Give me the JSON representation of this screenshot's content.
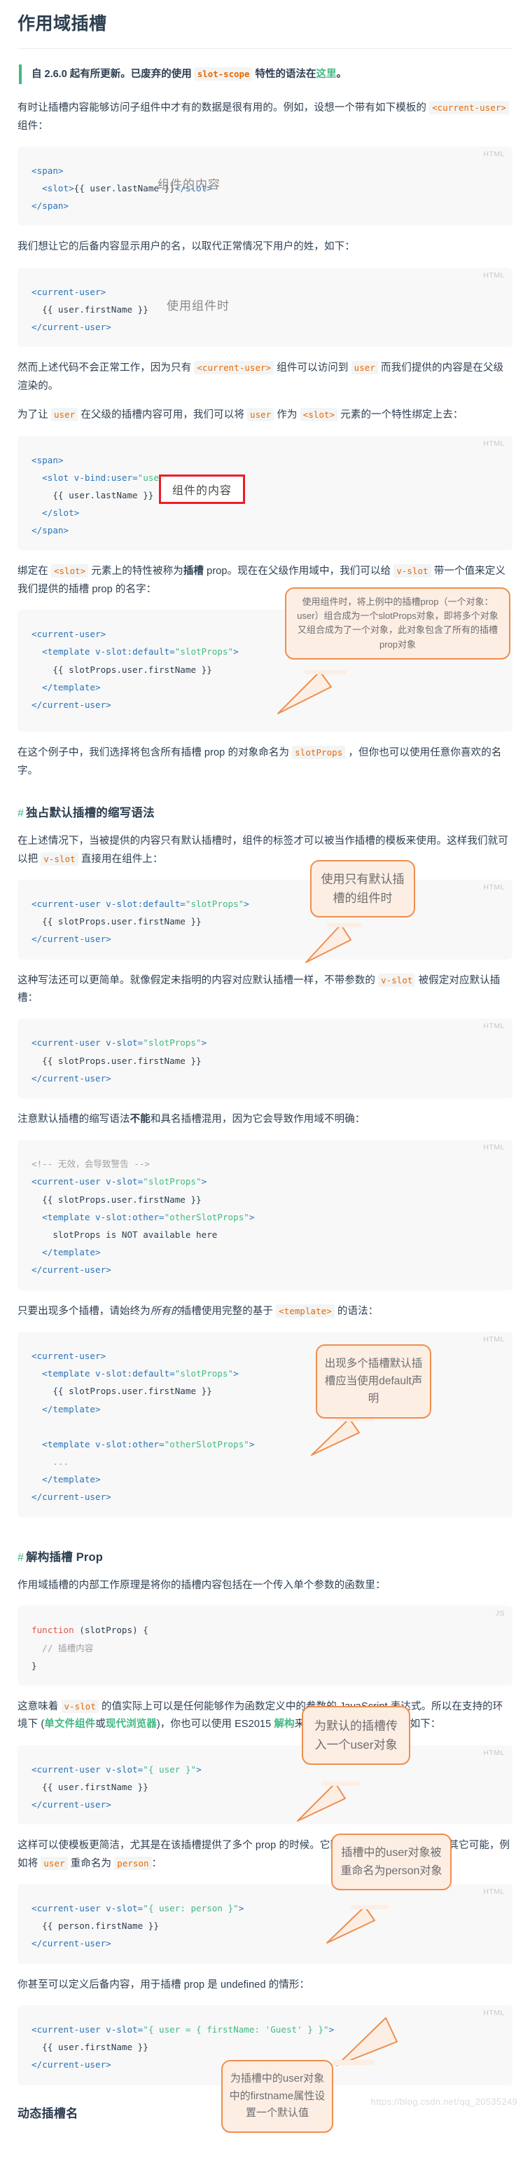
{
  "page": {
    "title": "作用域插槽",
    "watermark": "https://blog.csdn.net/qq_20535249"
  },
  "tip": {
    "prefix": "自 2.6.0 起有所更新。已废弃的使用 ",
    "code": "slot-scope",
    "middle": " 特性的语法在",
    "link": "这里",
    "suffix": "。"
  },
  "paragraphs": {
    "p1_a": "有时让插槽内容能够访问子组件中才有的数据是很有用的。例如，设想一个带有如下模板的 ",
    "p1_code": "<current-user>",
    "p1_b": " 组件：",
    "p2": "我们想让它的后备内容显示用户的名，以取代正常情况下用户的姓，如下：",
    "p3_a": "然而上述代码不会正常工作，因为只有 ",
    "p3_code1": "<current-user>",
    "p3_b": " 组件可以访问到 ",
    "p3_code2": "user",
    "p3_c": " 而我们提供的内容是在父级渲染的。",
    "p4_a": "为了让 ",
    "p4_code1": "user",
    "p4_b": " 在父级的插槽内容可用，我们可以将 ",
    "p4_code2": "user",
    "p4_c": " 作为 ",
    "p4_code3": "<slot>",
    "p4_d": " 元素的一个特性绑定上去：",
    "p5_a": "绑定在 ",
    "p5_code1": "<slot>",
    "p5_b": " 元素上的特性被称为",
    "p5_strong": "插槽",
    "p5_c": " prop。现在在父级作用域中，我们可以给 ",
    "p5_code2": "v-slot",
    "p5_d": " 带一个值来定义我们提供的插槽 prop 的名字：",
    "p6_a": "在这个例子中，我们选择将包含所有插槽 prop 的对象命名为 ",
    "p6_code": "slotProps",
    "p6_b": " ，但你也可以使用任意你喜欢的名字。",
    "p7_a": "在上述情况下，当被提供的内容只有默认插槽时，组件的标签才可以被当作插槽的模板来使用。这样我们就可以把 ",
    "p7_code": "v-slot",
    "p7_b": " 直接用在组件上：",
    "p8_a": "这种写法还可以更简单。就像假定未指明的内容对应默认插槽一样，不带参数的 ",
    "p8_code": "v-slot",
    "p8_b": " 被假定对应默认插槽：",
    "p9_a": "注意默认插槽的缩写语法",
    "p9_strong": "不能",
    "p9_b": "和具名插槽混用，因为它会导致作用域不明确：",
    "p10_a": "只要出现多个插槽，请始终为",
    "p10_em": "所有的",
    "p10_b": "插槽使用完整的基于 ",
    "p10_code": "<template>",
    "p10_c": " 的语法：",
    "p11": "作用域插槽的内部工作原理是将你的插槽内容包括在一个传入单个参数的函数里：",
    "p12_a": "这意味着 ",
    "p12_code": "v-slot",
    "p12_b": " 的值实际上可以是任何能够作为函数定义中的参数的 JavaScript 表达式。所以在支持的环境下 (",
    "p12_link1": "单文件组件",
    "p12_c": "或",
    "p12_link2": "现代浏览器",
    "p12_d": ")，你也可以使用 ",
    "p12_es": "ES2015",
    "p12_e": " ",
    "p12_link3": "解构",
    "p12_f": "来传入具体的插槽 prop，如下：",
    "p13_a": "这样可以使模板更简洁，尤其是在该插槽提供了多个 prop 的时候。它同样开启了 prop 重命名等其它可能，例如将 ",
    "p13_code1": "user",
    "p13_b": " 重命名为 ",
    "p13_code2": "person",
    "p13_c": "：",
    "p14": "你甚至可以定义后备内容，用于插槽 prop 是 undefined 的情形："
  },
  "sections": {
    "s1_anchor": "#",
    "s1_title": "独占默认插槽的缩写语法",
    "s2_anchor": "#",
    "s2_title": "解构插槽 Prop",
    "s3_title": "动态插槽名"
  },
  "code_blocks": [
    {
      "id": "cb1",
      "lang": "HTML",
      "lines": [
        [
          {
            "t": "tag",
            "v": "<span>"
          }
        ],
        [
          {
            "t": "txt",
            "v": "  "
          },
          {
            "t": "tag",
            "v": "<slot>"
          },
          {
            "t": "txt",
            "v": "{{ user.lastName }}"
          },
          {
            "t": "tag",
            "v": "</slot>"
          }
        ],
        [
          {
            "t": "tag",
            "v": "</span>"
          }
        ]
      ]
    },
    {
      "id": "cb2",
      "lang": "HTML",
      "lines": [
        [
          {
            "t": "tag",
            "v": "<current-user>"
          }
        ],
        [
          {
            "t": "txt",
            "v": "  {{ user.firstName }}"
          }
        ],
        [
          {
            "t": "tag",
            "v": "</current-user>"
          }
        ]
      ]
    },
    {
      "id": "cb3",
      "lang": "HTML",
      "lines": [
        [
          {
            "t": "tag",
            "v": "<span>"
          }
        ],
        [
          {
            "t": "txt",
            "v": "  "
          },
          {
            "t": "tag",
            "v": "<slot v-bind:user="
          },
          {
            "t": "str",
            "v": "\"user\""
          },
          {
            "t": "tag",
            "v": ">"
          }
        ],
        [
          {
            "t": "txt",
            "v": "    {{ user.lastName }}"
          }
        ],
        [
          {
            "t": "txt",
            "v": "  "
          },
          {
            "t": "tag",
            "v": "</slot>"
          }
        ],
        [
          {
            "t": "tag",
            "v": "</span>"
          }
        ]
      ]
    },
    {
      "id": "cb4",
      "lang": "HTML",
      "lines": [
        [
          {
            "t": "tag",
            "v": "<current-user>"
          }
        ],
        [
          {
            "t": "txt",
            "v": "  "
          },
          {
            "t": "tag",
            "v": "<template v-slot:default="
          },
          {
            "t": "str",
            "v": "\"slotProps\""
          },
          {
            "t": "tag",
            "v": ">"
          }
        ],
        [
          {
            "t": "txt",
            "v": "    {{ slotProps.user.firstName }}"
          }
        ],
        [
          {
            "t": "txt",
            "v": "  "
          },
          {
            "t": "tag",
            "v": "</template>"
          }
        ],
        [
          {
            "t": "tag",
            "v": "</current-user>"
          }
        ]
      ]
    },
    {
      "id": "cb5",
      "lang": "HTML",
      "lines": [
        [
          {
            "t": "tag",
            "v": "<current-user v-slot:default="
          },
          {
            "t": "str",
            "v": "\"slotProps\""
          },
          {
            "t": "tag",
            "v": ">"
          }
        ],
        [
          {
            "t": "txt",
            "v": "  {{ slotProps.user.firstName }}"
          }
        ],
        [
          {
            "t": "tag",
            "v": "</current-user>"
          }
        ]
      ]
    },
    {
      "id": "cb6",
      "lang": "HTML",
      "lines": [
        [
          {
            "t": "tag",
            "v": "<current-user v-slot="
          },
          {
            "t": "str",
            "v": "\"slotProps\""
          },
          {
            "t": "tag",
            "v": ">"
          }
        ],
        [
          {
            "t": "txt",
            "v": "  {{ slotProps.user.firstName }}"
          }
        ],
        [
          {
            "t": "tag",
            "v": "</current-user>"
          }
        ]
      ]
    },
    {
      "id": "cb7",
      "lang": "HTML",
      "lines": [
        [
          {
            "t": "cmt",
            "v": "<!-- 无效，会导致警告 -->"
          }
        ],
        [
          {
            "t": "tag",
            "v": "<current-user v-slot="
          },
          {
            "t": "str",
            "v": "\"slotProps\""
          },
          {
            "t": "tag",
            "v": ">"
          }
        ],
        [
          {
            "t": "txt",
            "v": "  {{ slotProps.user.firstName }}"
          }
        ],
        [
          {
            "t": "txt",
            "v": "  "
          },
          {
            "t": "tag",
            "v": "<template v-slot:other="
          },
          {
            "t": "str",
            "v": "\"otherSlotProps\""
          },
          {
            "t": "tag",
            "v": ">"
          }
        ],
        [
          {
            "t": "txt",
            "v": "    slotProps is NOT available here"
          }
        ],
        [
          {
            "t": "txt",
            "v": "  "
          },
          {
            "t": "tag",
            "v": "</template>"
          }
        ],
        [
          {
            "t": "tag",
            "v": "</current-user>"
          }
        ]
      ]
    },
    {
      "id": "cb8",
      "lang": "HTML",
      "lines": [
        [
          {
            "t": "tag",
            "v": "<current-user>"
          }
        ],
        [
          {
            "t": "txt",
            "v": "  "
          },
          {
            "t": "tag",
            "v": "<template v-slot:default="
          },
          {
            "t": "str",
            "v": "\"slotProps\""
          },
          {
            "t": "tag",
            "v": ">"
          }
        ],
        [
          {
            "t": "txt",
            "v": "    {{ slotProps.user.firstName }}"
          }
        ],
        [
          {
            "t": "txt",
            "v": "  "
          },
          {
            "t": "tag",
            "v": "</template>"
          }
        ],
        [
          {
            "t": "txt",
            "v": ""
          }
        ],
        [
          {
            "t": "txt",
            "v": "  "
          },
          {
            "t": "tag",
            "v": "<template v-slot:other="
          },
          {
            "t": "str",
            "v": "\"otherSlotProps\""
          },
          {
            "t": "tag",
            "v": ">"
          }
        ],
        [
          {
            "t": "cmt",
            "v": "    ..."
          }
        ],
        [
          {
            "t": "txt",
            "v": "  "
          },
          {
            "t": "tag",
            "v": "</template>"
          }
        ],
        [
          {
            "t": "tag",
            "v": "</current-user>"
          }
        ]
      ]
    },
    {
      "id": "cb9",
      "lang": "JS",
      "lines": [
        [
          {
            "t": "kw",
            "v": "function"
          },
          {
            "t": "punct",
            "v": " (slotProps) {"
          }
        ],
        [
          {
            "t": "cmt",
            "v": "  // 插槽内容"
          }
        ],
        [
          {
            "t": "punct",
            "v": "}"
          }
        ]
      ]
    },
    {
      "id": "cb10",
      "lang": "HTML",
      "lines": [
        [
          {
            "t": "tag",
            "v": "<current-user v-slot="
          },
          {
            "t": "str",
            "v": "\"{ user }\""
          },
          {
            "t": "tag",
            "v": ">"
          }
        ],
        [
          {
            "t": "txt",
            "v": "  {{ user.firstName }}"
          }
        ],
        [
          {
            "t": "tag",
            "v": "</current-user>"
          }
        ]
      ]
    },
    {
      "id": "cb11",
      "lang": "HTML",
      "lines": [
        [
          {
            "t": "tag",
            "v": "<current-user v-slot="
          },
          {
            "t": "str",
            "v": "\"{ user: person }\""
          },
          {
            "t": "tag",
            "v": ">"
          }
        ],
        [
          {
            "t": "txt",
            "v": "  {{ person.firstName }}"
          }
        ],
        [
          {
            "t": "tag",
            "v": "</current-user>"
          }
        ]
      ]
    },
    {
      "id": "cb12",
      "lang": "HTML",
      "lines": [
        [
          {
            "t": "tag",
            "v": "<current-user v-slot="
          },
          {
            "t": "str",
            "v": "\"{ user = { firstName: 'Guest' } }\""
          },
          {
            "t": "tag",
            "v": ">"
          }
        ],
        [
          {
            "t": "txt",
            "v": "  {{ user.firstName }}"
          }
        ],
        [
          {
            "t": "tag",
            "v": "</current-user>"
          }
        ]
      ]
    }
  ],
  "annotations": {
    "a1": "组件的内容",
    "a2": "使用组件时",
    "a3": "组件的内容",
    "a4": "使用组件时，将上例中的插槽prop（一个对象：user）组合成为一个slotProps对象，即将多个对象又组合成为了一个对象，此对象包含了所有的插槽prop对象",
    "a5": "使用只有默认插槽的组件时",
    "a6": "出现多个插槽默认插槽应当使用default声明",
    "a7": "为默认的插槽传入一个user对象",
    "a8": "插槽中的user对象被重命名为person对象",
    "a9": "为插槽中的user对象中的firstname属性设置一个默认值"
  },
  "colors": {
    "accent_green": "#42b983",
    "inline_code": "#e96900",
    "code_tag": "#2973b7",
    "code_string": "#42b983",
    "bubble_bg": "#fdeee4",
    "bubble_border": "#ef8e4e",
    "rect_border": "#ee1c25"
  }
}
